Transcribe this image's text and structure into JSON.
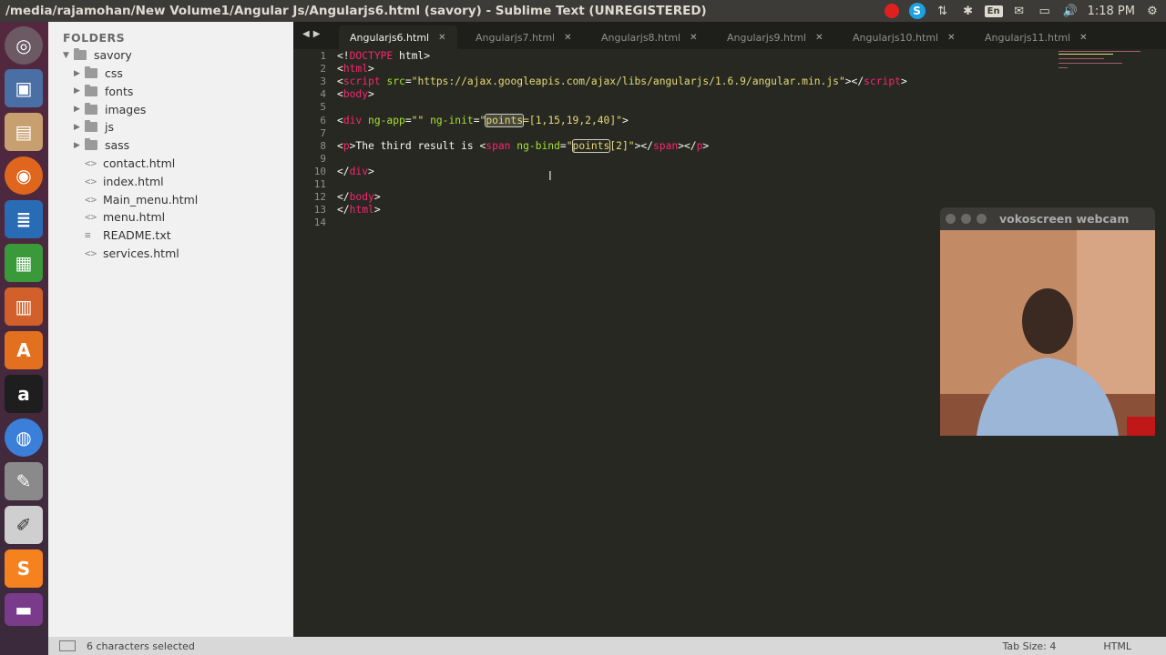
{
  "top_panel": {
    "window_title": "/media/rajamohan/New Volume1/Angular Js/Angularjs6.html (savory) - Sublime Text (UNREGISTERED)",
    "clock": "1:18 PM",
    "keyboard": "En",
    "tray_icons": [
      "record-icon",
      "skype-icon",
      "network-icon",
      "keyboard-layout-icon",
      "mail-icon",
      "battery-icon",
      "volume-icon",
      "settings-icon"
    ]
  },
  "launcher": {
    "items": [
      "ubuntu-dash-icon",
      "system-settings-icon",
      "files-icon",
      "firefox-icon",
      "libreoffice-writer-icon",
      "libreoffice-calc-icon",
      "libreoffice-impress-icon",
      "software-center-icon",
      "amazon-icon",
      "chromium-icon",
      "settings-icon",
      "text-editor-icon",
      "sublime-text-icon",
      "trash-icon"
    ]
  },
  "sidebar": {
    "heading": "FOLDERS",
    "root": "savory",
    "folders": [
      "css",
      "fonts",
      "images",
      "js",
      "sass"
    ],
    "files": [
      {
        "name": "contact.html",
        "icon": "<>"
      },
      {
        "name": "index.html",
        "icon": "<>"
      },
      {
        "name": "Main_menu.html",
        "icon": "<>"
      },
      {
        "name": "menu.html",
        "icon": "<>"
      },
      {
        "name": "README.txt",
        "icon": "≡"
      },
      {
        "name": "services.html",
        "icon": "<>"
      }
    ]
  },
  "tabs": [
    {
      "label": "Angularjs6.html",
      "active": true
    },
    {
      "label": "Angularjs7.html",
      "active": false
    },
    {
      "label": "Angularjs8.html",
      "active": false
    },
    {
      "label": "Angularjs9.html",
      "active": false
    },
    {
      "label": "Angularjs10.html",
      "active": false
    },
    {
      "label": "Angularjs11.html",
      "active": false
    }
  ],
  "code": {
    "line_numbers": [
      "1",
      "2",
      "3",
      "4",
      "5",
      "6",
      "7",
      "8",
      "9",
      "10",
      "11",
      "12",
      "13",
      "14"
    ],
    "lines": [
      [
        {
          "t": "<!",
          "c": "pl"
        },
        {
          "t": "DOCTYPE",
          "c": "tg"
        },
        {
          "t": " html>",
          "c": "pl"
        }
      ],
      [
        {
          "t": "<",
          "c": "pl"
        },
        {
          "t": "html",
          "c": "tg"
        },
        {
          "t": ">",
          "c": "pl"
        }
      ],
      [
        {
          "t": "<",
          "c": "pl"
        },
        {
          "t": "script",
          "c": "tg"
        },
        {
          "t": " ",
          "c": "pl"
        },
        {
          "t": "src",
          "c": "at"
        },
        {
          "t": "=",
          "c": "pl"
        },
        {
          "t": "\"https://ajax.googleapis.com/ajax/libs/angularjs/1.6.9/angular.min.js\"",
          "c": "st"
        },
        {
          "t": "></",
          "c": "pl"
        },
        {
          "t": "script",
          "c": "tg"
        },
        {
          "t": ">",
          "c": "pl"
        }
      ],
      [
        {
          "t": "<",
          "c": "pl"
        },
        {
          "t": "body",
          "c": "tg"
        },
        {
          "t": ">",
          "c": "pl"
        }
      ],
      [],
      [
        {
          "t": "<",
          "c": "pl"
        },
        {
          "t": "div",
          "c": "tg"
        },
        {
          "t": " ",
          "c": "pl"
        },
        {
          "t": "ng-app",
          "c": "at"
        },
        {
          "t": "=",
          "c": "pl"
        },
        {
          "t": "\"\"",
          "c": "st"
        },
        {
          "t": " ",
          "c": "pl"
        },
        {
          "t": "ng-init",
          "c": "at"
        },
        {
          "t": "=",
          "c": "pl"
        },
        {
          "t": "\"",
          "c": "st"
        },
        {
          "t": "points",
          "c": "st hl sel"
        },
        {
          "t": "=[1,15,19,2,40]\"",
          "c": "st"
        },
        {
          "t": ">",
          "c": "pl"
        }
      ],
      [],
      [
        {
          "t": "<",
          "c": "pl"
        },
        {
          "t": "p",
          "c": "tg"
        },
        {
          "t": ">The third result is <",
          "c": "pl"
        },
        {
          "t": "span",
          "c": "tg"
        },
        {
          "t": " ",
          "c": "pl"
        },
        {
          "t": "ng-bind",
          "c": "at"
        },
        {
          "t": "=",
          "c": "pl"
        },
        {
          "t": "\"",
          "c": "st"
        },
        {
          "t": "points",
          "c": "st hl"
        },
        {
          "t": "[2]\"",
          "c": "st"
        },
        {
          "t": "></",
          "c": "pl"
        },
        {
          "t": "span",
          "c": "tg"
        },
        {
          "t": "></",
          "c": "pl"
        },
        {
          "t": "p",
          "c": "tg"
        },
        {
          "t": ">",
          "c": "pl"
        }
      ],
      [],
      [
        {
          "t": "</",
          "c": "pl"
        },
        {
          "t": "div",
          "c": "tg"
        },
        {
          "t": ">",
          "c": "pl"
        }
      ],
      [],
      [
        {
          "t": "</",
          "c": "pl"
        },
        {
          "t": "body",
          "c": "tg"
        },
        {
          "t": ">",
          "c": "pl"
        }
      ],
      [
        {
          "t": "</",
          "c": "pl"
        },
        {
          "t": "html",
          "c": "tg"
        },
        {
          "t": ">",
          "c": "pl"
        }
      ],
      []
    ]
  },
  "webcam": {
    "title": "vokoscreen webcam"
  },
  "statusbar": {
    "selection": "6 characters selected",
    "tab_size": "Tab Size: 4",
    "syntax": "HTML"
  },
  "colors": {
    "editor_bg": "#272822",
    "sidebar_bg": "#f1f1f1",
    "tag": "#f92672",
    "attribute": "#a6e22e",
    "string": "#e6db74"
  }
}
